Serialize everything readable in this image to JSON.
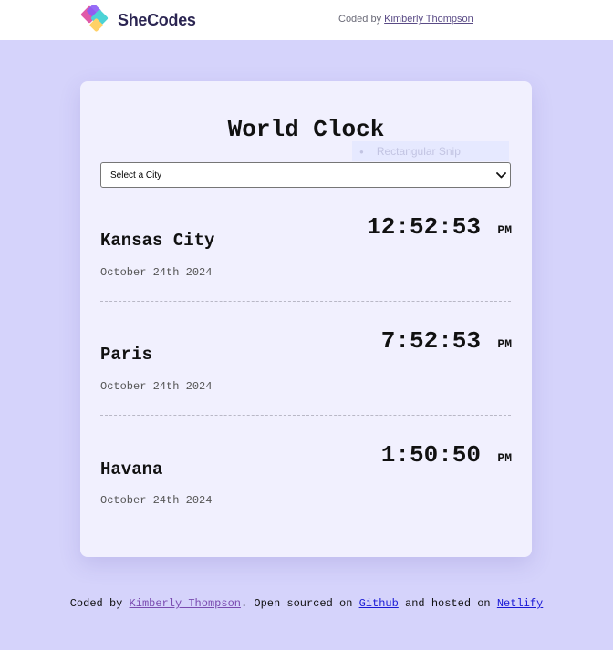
{
  "brand": {
    "logo_text": "SheCodes",
    "logo_colors": [
      "#e05aa8",
      "#8b5cf6",
      "#4cd3d6",
      "#ffd166"
    ]
  },
  "header": {
    "coded_by_prefix": "Coded by",
    "author_link": "Kimberly Thompson"
  },
  "card": {
    "title": "World Clock",
    "select": {
      "selected": "Select a City"
    },
    "overlay_label": "Rectangular Snip",
    "cities": [
      {
        "name": "Kansas City",
        "date": "October 24th 2024",
        "time": "12:52:53",
        "ampm": "PM"
      },
      {
        "name": "Paris",
        "date": "October 24th 2024",
        "time": "7:52:53",
        "ampm": "PM"
      },
      {
        "name": "Havana",
        "date": "October 24th 2024",
        "time": "1:50:50",
        "ampm": "PM"
      }
    ]
  },
  "footer": {
    "prefix": "Coded by",
    "author_link": "Kimberly Thompson",
    "middle": ". Open sourced on",
    "github_link": "Github",
    "hosted": "and hosted on",
    "netlify_link": "Netlify"
  },
  "colors": {
    "background": "#d5d3fb",
    "card": "#f1f0fe",
    "topbar": "#ffffff"
  }
}
